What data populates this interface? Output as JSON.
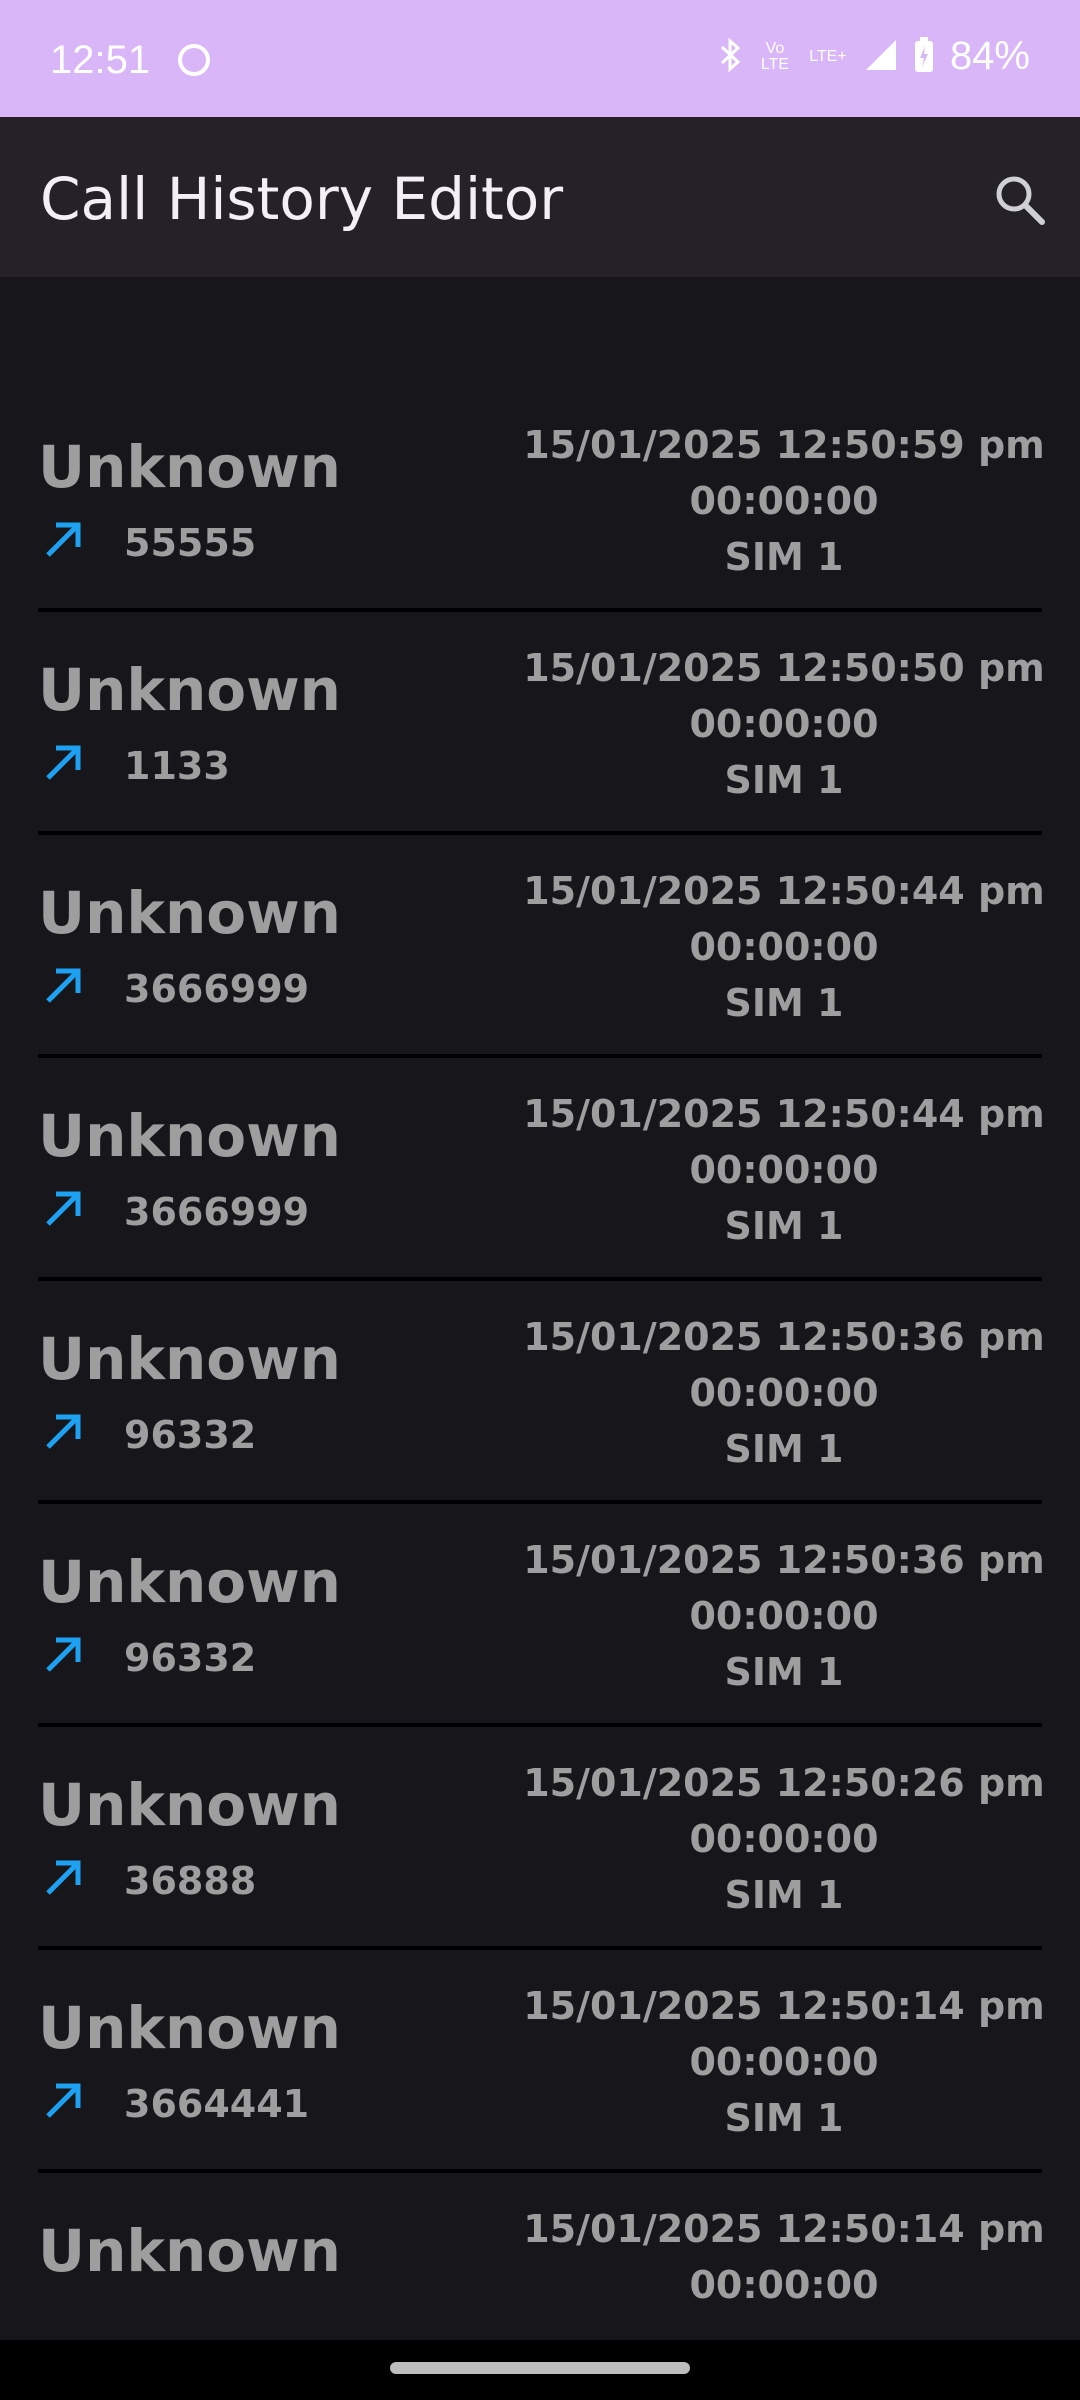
{
  "status_bar": {
    "time": "12:51",
    "icons": [
      "bluetooth-icon",
      "volte-icon",
      "lte-plus-icon",
      "signal-icon",
      "battery-icon"
    ],
    "volte_label": "Vo LTE",
    "lte_label": "LTE+",
    "battery": "84%"
  },
  "app_bar": {
    "title": "Call History Editor",
    "search_icon": "search-icon"
  },
  "colors": {
    "status_bar_bg": "#d9b6f7",
    "app_bar_bg": "#242228",
    "list_bg": "#17161b",
    "text_gray": "#9e9e9e",
    "outgoing_arrow": "#1da1f2"
  },
  "calls": [
    {
      "name": "Unknown",
      "number": "55555",
      "datetime": "15/01/2025 12:50:59 pm",
      "duration": "00:00:00",
      "sim": "SIM 1",
      "direction_icon": "outgoing-call-icon"
    },
    {
      "name": "Unknown",
      "number": "1133",
      "datetime": "15/01/2025 12:50:50 pm",
      "duration": "00:00:00",
      "sim": "SIM 1",
      "direction_icon": "outgoing-call-icon"
    },
    {
      "name": "Unknown",
      "number": "3666999",
      "datetime": "15/01/2025 12:50:44 pm",
      "duration": "00:00:00",
      "sim": "SIM 1",
      "direction_icon": "outgoing-call-icon"
    },
    {
      "name": "Unknown",
      "number": "3666999",
      "datetime": "15/01/2025 12:50:44 pm",
      "duration": "00:00:00",
      "sim": "SIM 1",
      "direction_icon": "outgoing-call-icon"
    },
    {
      "name": "Unknown",
      "number": "96332",
      "datetime": "15/01/2025 12:50:36 pm",
      "duration": "00:00:00",
      "sim": "SIM 1",
      "direction_icon": "outgoing-call-icon"
    },
    {
      "name": "Unknown",
      "number": "96332",
      "datetime": "15/01/2025 12:50:36 pm",
      "duration": "00:00:00",
      "sim": "SIM 1",
      "direction_icon": "outgoing-call-icon"
    },
    {
      "name": "Unknown",
      "number": "36888",
      "datetime": "15/01/2025 12:50:26 pm",
      "duration": "00:00:00",
      "sim": "SIM 1",
      "direction_icon": "outgoing-call-icon"
    },
    {
      "name": "Unknown",
      "number": "3664441",
      "datetime": "15/01/2025 12:50:14 pm",
      "duration": "00:00:00",
      "sim": "SIM 1",
      "direction_icon": "outgoing-call-icon"
    },
    {
      "name": "Unknown",
      "number": "",
      "datetime": "15/01/2025 12:50:14 pm",
      "duration": "00:00:00",
      "sim": "",
      "direction_icon": ""
    }
  ]
}
